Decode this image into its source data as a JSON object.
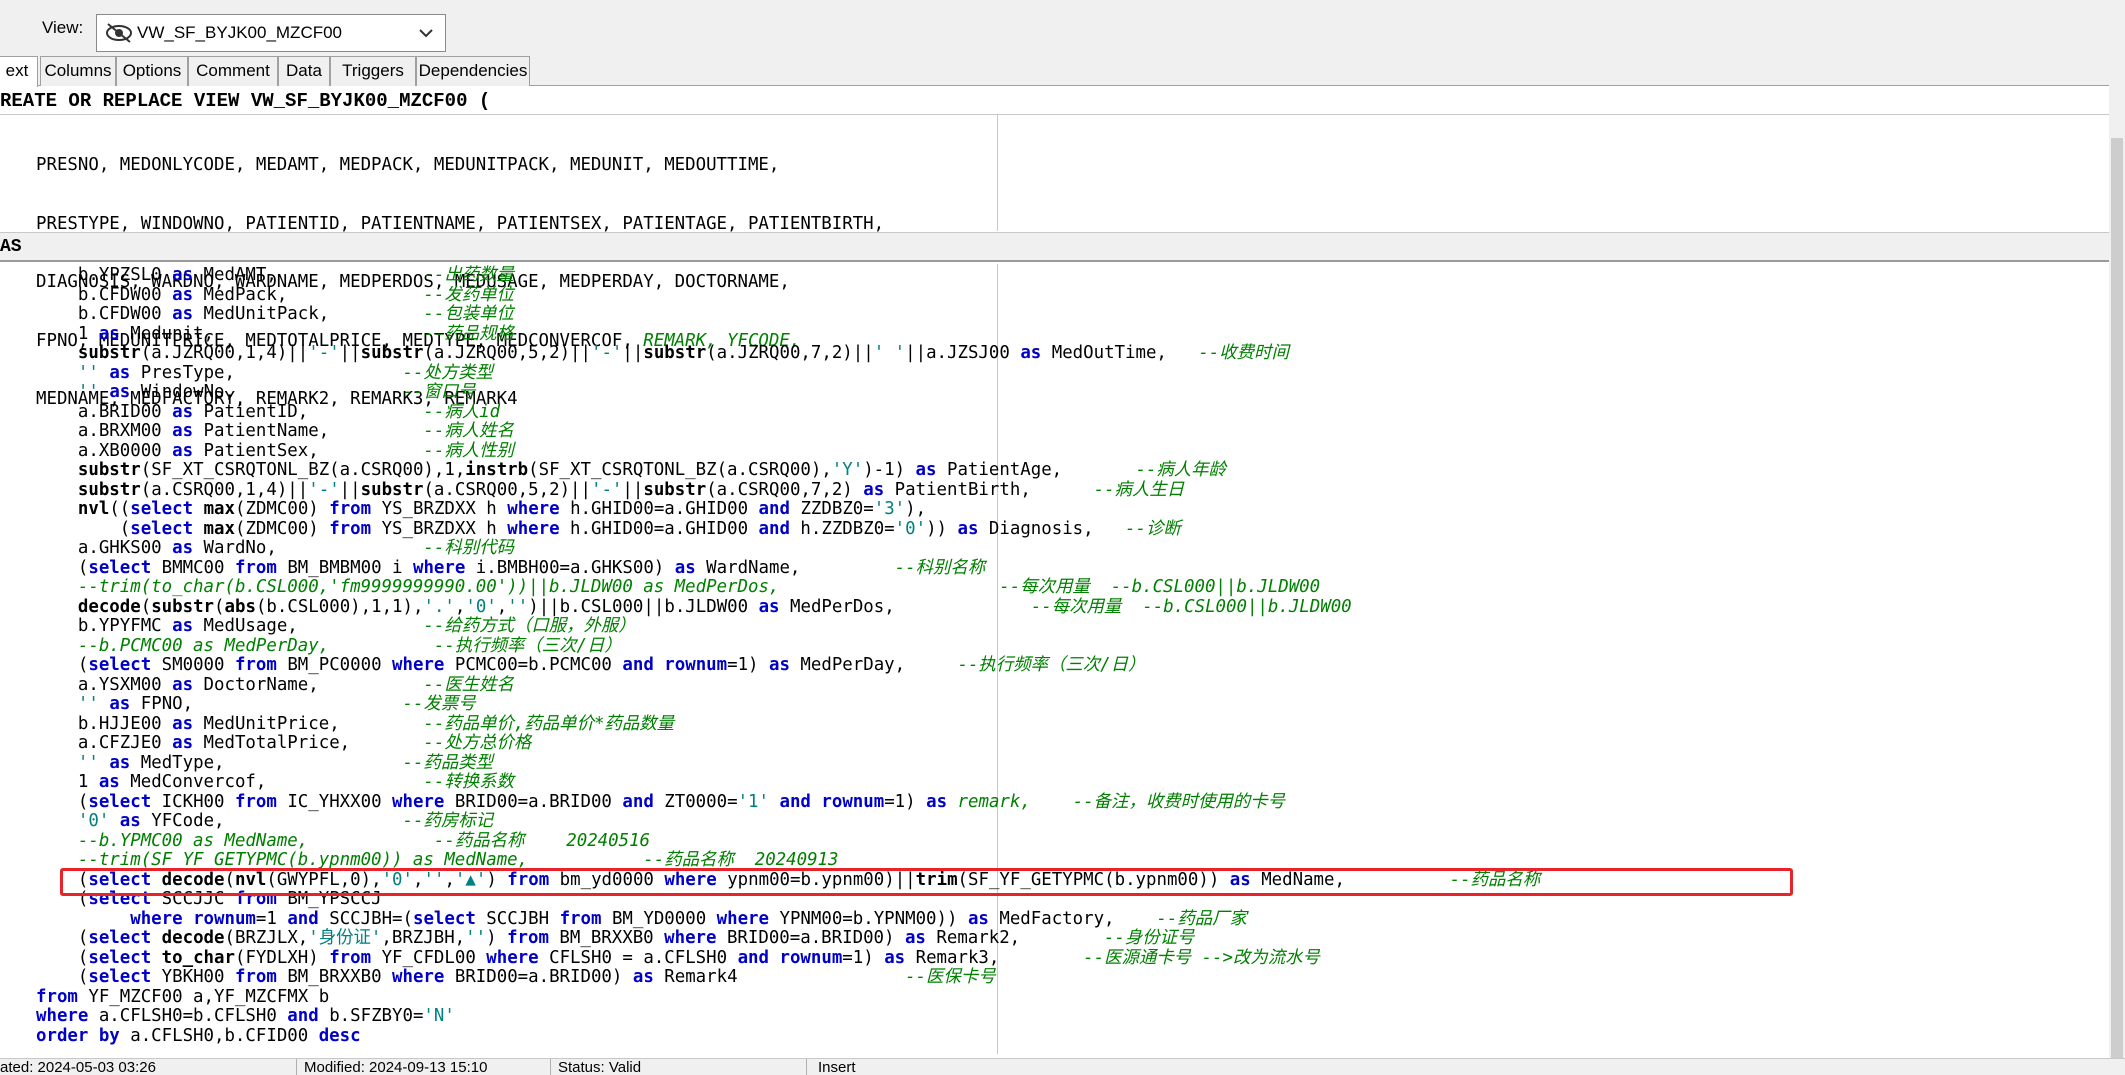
{
  "toolbar": {
    "view_label": "View:",
    "view_value": "VW_SF_BYJK00_MZCF00"
  },
  "tabs": [
    {
      "label": "ext"
    },
    {
      "label": "Columns"
    },
    {
      "label": "Options"
    },
    {
      "label": "Comment"
    },
    {
      "label": "Data"
    },
    {
      "label": "Triggers"
    },
    {
      "label": "Dependencies"
    }
  ],
  "header_line": "REATE OR REPLACE VIEW VW_SF_BYJK00_MZCF00 (",
  "column_list": [
    "PRESNO, MEDONLYCODE, MEDAMT, MEDPACK, MEDUNITPACK, MEDUNIT, MEDOUTTIME,",
    "PRESTYPE, WINDOWNO, PATIENTID, PATIENTNAME, PATIENTSEX, PATIENTAGE, PATIENTBIRTH,",
    "DIAGNOSIS, WARDNO, WARDNAME, MEDPERDOS, MEDUSAGE, MEDPERDAY, DOCTORNAME,",
    "FPNO, MEDUNITPRICE, MEDTOTALPRICE, MEDTYPE, MEDCONVERCOF, ",
    "MEDNAME, MEDFACTORY, REMARK2, REMARK3, REMARK4"
  ],
  "column_list_italic": "REMARK, YFCODE,",
  "as_label": "AS",
  "status": {
    "created": "ated: 2024-05-03 03:26",
    "modified": "Modified: 2024-09-13 15:10",
    "status": "Status: Valid",
    "mode": "Insert"
  },
  "colors": {
    "keyword": "#0000c8",
    "string": "#008080",
    "comment": "#008000",
    "highlight": "#e8232a"
  }
}
